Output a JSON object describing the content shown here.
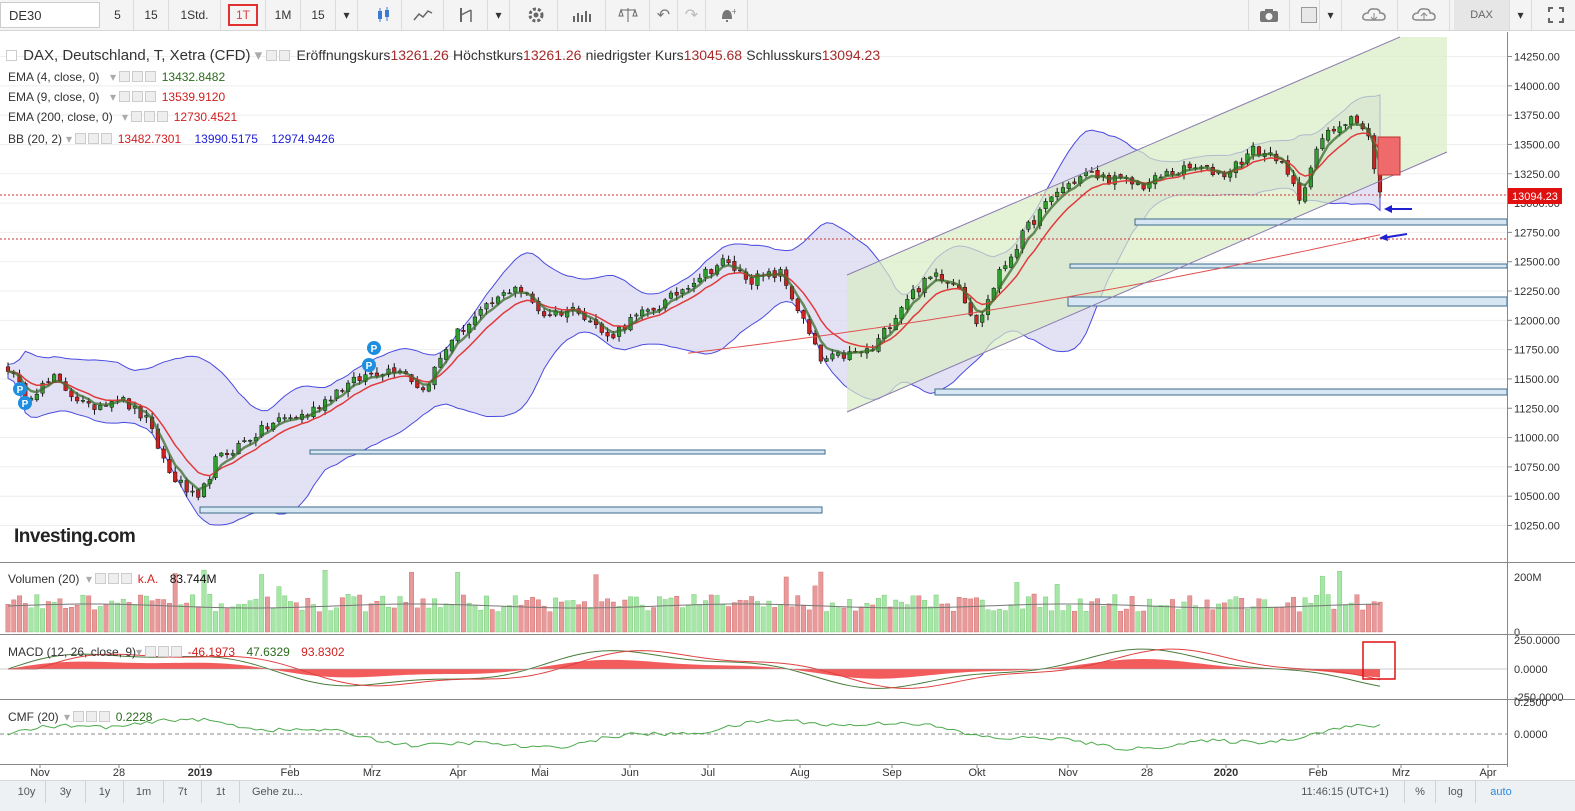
{
  "toolbar": {
    "symbol": "DE30",
    "intervals": [
      "5",
      "15",
      "1Std.",
      "1T",
      "1M",
      "15"
    ],
    "active_interval": "1T",
    "exchange_button": "DAX",
    "icons": [
      "candles-icon",
      "line-chart-icon",
      "indicators-icon",
      "settings-icon",
      "bars-icon",
      "scale-icon",
      "undo-icon",
      "redo-icon",
      "alert-icon",
      "camera-icon",
      "color-swatch-icon",
      "cloud-download-icon",
      "cloud-upload-icon",
      "fullscreen-icon"
    ]
  },
  "legends": {
    "main_title": "DAX, Deutschland, T, Xetra (CFD)",
    "open_label": "Eröffnungskurs",
    "open_value": "13261.26",
    "high_label": "Höchstkurs",
    "high_value": "13261.26",
    "low_label": "niedrigster Kurs",
    "low_value": "13045.68",
    "close_label": "Schlusskurs",
    "close_value": "13094.23",
    "ema4_label": "EMA (4, close, 0)",
    "ema4_value": "13432.8482",
    "ema9_label": "EMA (9, close, 0)",
    "ema9_value": "13539.9120",
    "ema200_label": "EMA (200, close, 0)",
    "ema200_value": "12730.4521",
    "bb_label": "BB (20, 2)",
    "bb_mid": "13482.7301",
    "bb_upper": "13990.5175",
    "bb_lower": "12974.9426",
    "vol_label": "Volumen (20)",
    "vol_na": "k.A.",
    "vol_value": "83.744M",
    "macd_label": "MACD (12, 26, close, 9)",
    "macd_v1": "-46.1973",
    "macd_v2": "47.6329",
    "macd_v3": "93.8302",
    "cmf_label": "CMF (20)",
    "cmf_value": "0.2228",
    "logo": "Investing.com"
  },
  "colors": {
    "up": "#2e9e2e",
    "down": "#cc2222",
    "bb_fill": "#d8d8f0",
    "bb_line": "#4a4adf",
    "channel_fill": "#d9ecc5",
    "ema4": "#3a6b2a",
    "ema9": "#e03a3a",
    "ema200": "#e05050",
    "price_tag": "#e01010"
  },
  "chart_data": {
    "type": "candlestick",
    "title": "DAX, Deutschland, T, Xetra (CFD)",
    "x_ticks": [
      "Nov",
      "28",
      "2019",
      "Feb",
      "Mrz",
      "Apr",
      "Mai",
      "Jun",
      "Jul",
      "Aug",
      "Sep",
      "Okt",
      "Nov",
      "28",
      "2020",
      "Feb",
      "Mrz",
      "Apr"
    ],
    "y_ticks": [
      "14250.00",
      "14000.00",
      "13750.00",
      "13500.00",
      "13250.00",
      "13000.00",
      "12750.00",
      "12500.00",
      "12250.00",
      "12000.00",
      "11750.00",
      "11500.00",
      "11250.00",
      "11000.00",
      "10750.00",
      "10500.00",
      "10250.00"
    ],
    "ylim": [
      10100,
      14400
    ],
    "last_price": "13094.23",
    "close_path": [
      {
        "t": 0,
        "v": 11600
      },
      {
        "t": 3,
        "v": 11350
      },
      {
        "t": 8,
        "v": 11500
      },
      {
        "t": 14,
        "v": 11250
      },
      {
        "t": 19,
        "v": 11350
      },
      {
        "t": 24,
        "v": 11150
      },
      {
        "t": 28,
        "v": 10700
      },
      {
        "t": 33,
        "v": 10450
      },
      {
        "t": 36,
        "v": 10800
      },
      {
        "t": 42,
        "v": 11000
      },
      {
        "t": 47,
        "v": 11150
      },
      {
        "t": 52,
        "v": 11200
      },
      {
        "t": 57,
        "v": 11400
      },
      {
        "t": 63,
        "v": 11550
      },
      {
        "t": 68,
        "v": 11600
      },
      {
        "t": 72,
        "v": 11400
      },
      {
        "t": 77,
        "v": 11850
      },
      {
        "t": 83,
        "v": 12100
      },
      {
        "t": 88,
        "v": 12300
      },
      {
        "t": 93,
        "v": 12050
      },
      {
        "t": 99,
        "v": 12100
      },
      {
        "t": 104,
        "v": 11850
      },
      {
        "t": 108,
        "v": 12000
      },
      {
        "t": 114,
        "v": 12150
      },
      {
        "t": 119,
        "v": 12350
      },
      {
        "t": 124,
        "v": 12500
      },
      {
        "t": 129,
        "v": 12350
      },
      {
        "t": 134,
        "v": 12400
      },
      {
        "t": 137,
        "v": 12100
      },
      {
        "t": 141,
        "v": 11650
      },
      {
        "t": 145,
        "v": 11700
      },
      {
        "t": 150,
        "v": 11750
      },
      {
        "t": 156,
        "v": 12200
      },
      {
        "t": 161,
        "v": 12400
      },
      {
        "t": 165,
        "v": 12300
      },
      {
        "t": 168,
        "v": 11950
      },
      {
        "t": 172,
        "v": 12400
      },
      {
        "t": 177,
        "v": 12800
      },
      {
        "t": 182,
        "v": 13100
      },
      {
        "t": 187,
        "v": 13250
      },
      {
        "t": 192,
        "v": 13200
      },
      {
        "t": 197,
        "v": 13150
      },
      {
        "t": 201,
        "v": 13250
      },
      {
        "t": 206,
        "v": 13300
      },
      {
        "t": 211,
        "v": 13250
      },
      {
        "t": 216,
        "v": 13450
      },
      {
        "t": 220,
        "v": 13400
      },
      {
        "t": 224,
        "v": 13050
      },
      {
        "t": 228,
        "v": 13550
      },
      {
        "t": 233,
        "v": 13750
      },
      {
        "t": 236,
        "v": 13550
      },
      {
        "t": 238,
        "v": 13094
      }
    ],
    "volume_ylim": [
      0,
      200
    ],
    "volume_ticks": [
      "200M",
      "0"
    ],
    "macd_ticks": [
      "250.0000",
      "0.0000",
      "-250.0000"
    ],
    "cmf_ticks": [
      "0.2500",
      "0.0000"
    ]
  },
  "bottombar": {
    "ranges": [
      "10y",
      "3y",
      "1y",
      "1m",
      "7t",
      "1t"
    ],
    "goto": "Gehe zu...",
    "time": "11:46:15 (UTC+1)",
    "percent": "%",
    "log": "log",
    "auto": "auto"
  }
}
